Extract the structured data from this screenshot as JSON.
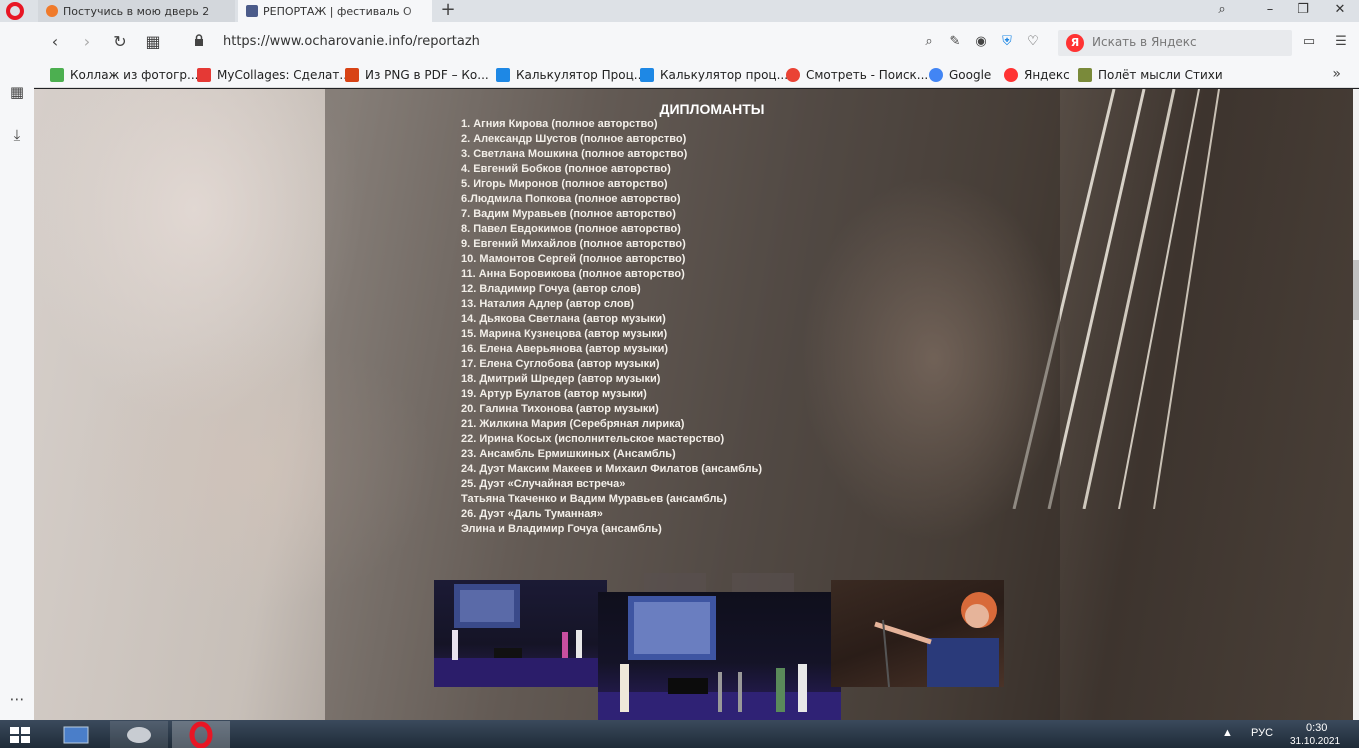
{
  "tabs": [
    {
      "title": "Постучись в мою дверь 2"
    },
    {
      "title": "РЕПОРТАЖ | фестиваль О"
    }
  ],
  "address": {
    "url": "https://www.ocharovanie.info/reportazh"
  },
  "search": {
    "placeholder": "Искать в Яндекс",
    "logo": "Я"
  },
  "bookmarks": [
    {
      "label": "Коллаж из фотогр...",
      "color": "#4caf50"
    },
    {
      "label": "MyCollages: Сделат...",
      "color": "#e53935"
    },
    {
      "label": "Из PNG в PDF – Ко...",
      "color": "#d84315"
    },
    {
      "label": "Калькулятор Проц...",
      "color": "#1e88e5"
    },
    {
      "label": "Калькулятор проц...",
      "color": "#1e88e5"
    },
    {
      "label": "Смотреть - Поиск...",
      "color": "#ea4335"
    },
    {
      "label": "Google",
      "color": "#4285f4"
    },
    {
      "label": "Яндекс",
      "color": "#f33"
    },
    {
      "label": "Полёт мысли Стихи",
      "color": "#7a8a3a"
    }
  ],
  "content": {
    "heading": "ДИПЛОМАНТЫ",
    "items": [
      "1. Агния Кирова (полное авторство)",
      "2. Александр Шустов (полное авторство)",
      "3. Светлана Мошкина (полное авторство)",
      "4. Евгений Бобков (полное авторство)",
      "5. Игорь Миронов (полное авторство)",
      "6.Людмила Попкова (полное авторство)",
      "7. Вадим Муравьев (полное авторство)",
      "8. Павел Евдокимов (полное авторство)",
      "9. Евгений Михайлов (полное авторство)",
      "10. Мамонтов Сергей  (полное авторство)",
      "11. Анна Боровикова  (полное авторство)",
      "12. Владимир Гочуа (автор слов)",
      "13. Наталия Адлер  (автор слов)",
      "14. Дьякова Светлана (автор музыки)",
      "15. Марина Кузнецова (автор музыки)",
      "16. Елена Аверьянова (автор музыки)",
      "17. Елена Суглобова (автор музыки)",
      "18. Дмитрий Шредер (автор музыки)",
      "19. Артур Булатов (автор музыки)",
      "20. Галина Тихонова  (автор музыки)",
      "21. Жилкина Мария (Серебряная лирика)",
      "22. Ирина Косых (исполнительское мастерство)",
      "23. Ансамбль Ермишкиных (Ансамбль)",
      "24. Дуэт Максим Макеев и Михаил Филатов (ансамбль)",
      "25. Дуэт «Случайная встреча»",
      "Татьяна Ткаченко и Вадим Муравьев (ансамбль)",
      "26. Дуэт «Даль Туманная»",
      "Элина и Владимир Гочуа (ансамбль)"
    ]
  },
  "taskbar": {
    "lang": "РУС",
    "time": "0:30",
    "date": "31.10.2021"
  },
  "colors": {
    "opera_red": "#e81624",
    "accent": "#4b5b8a"
  }
}
